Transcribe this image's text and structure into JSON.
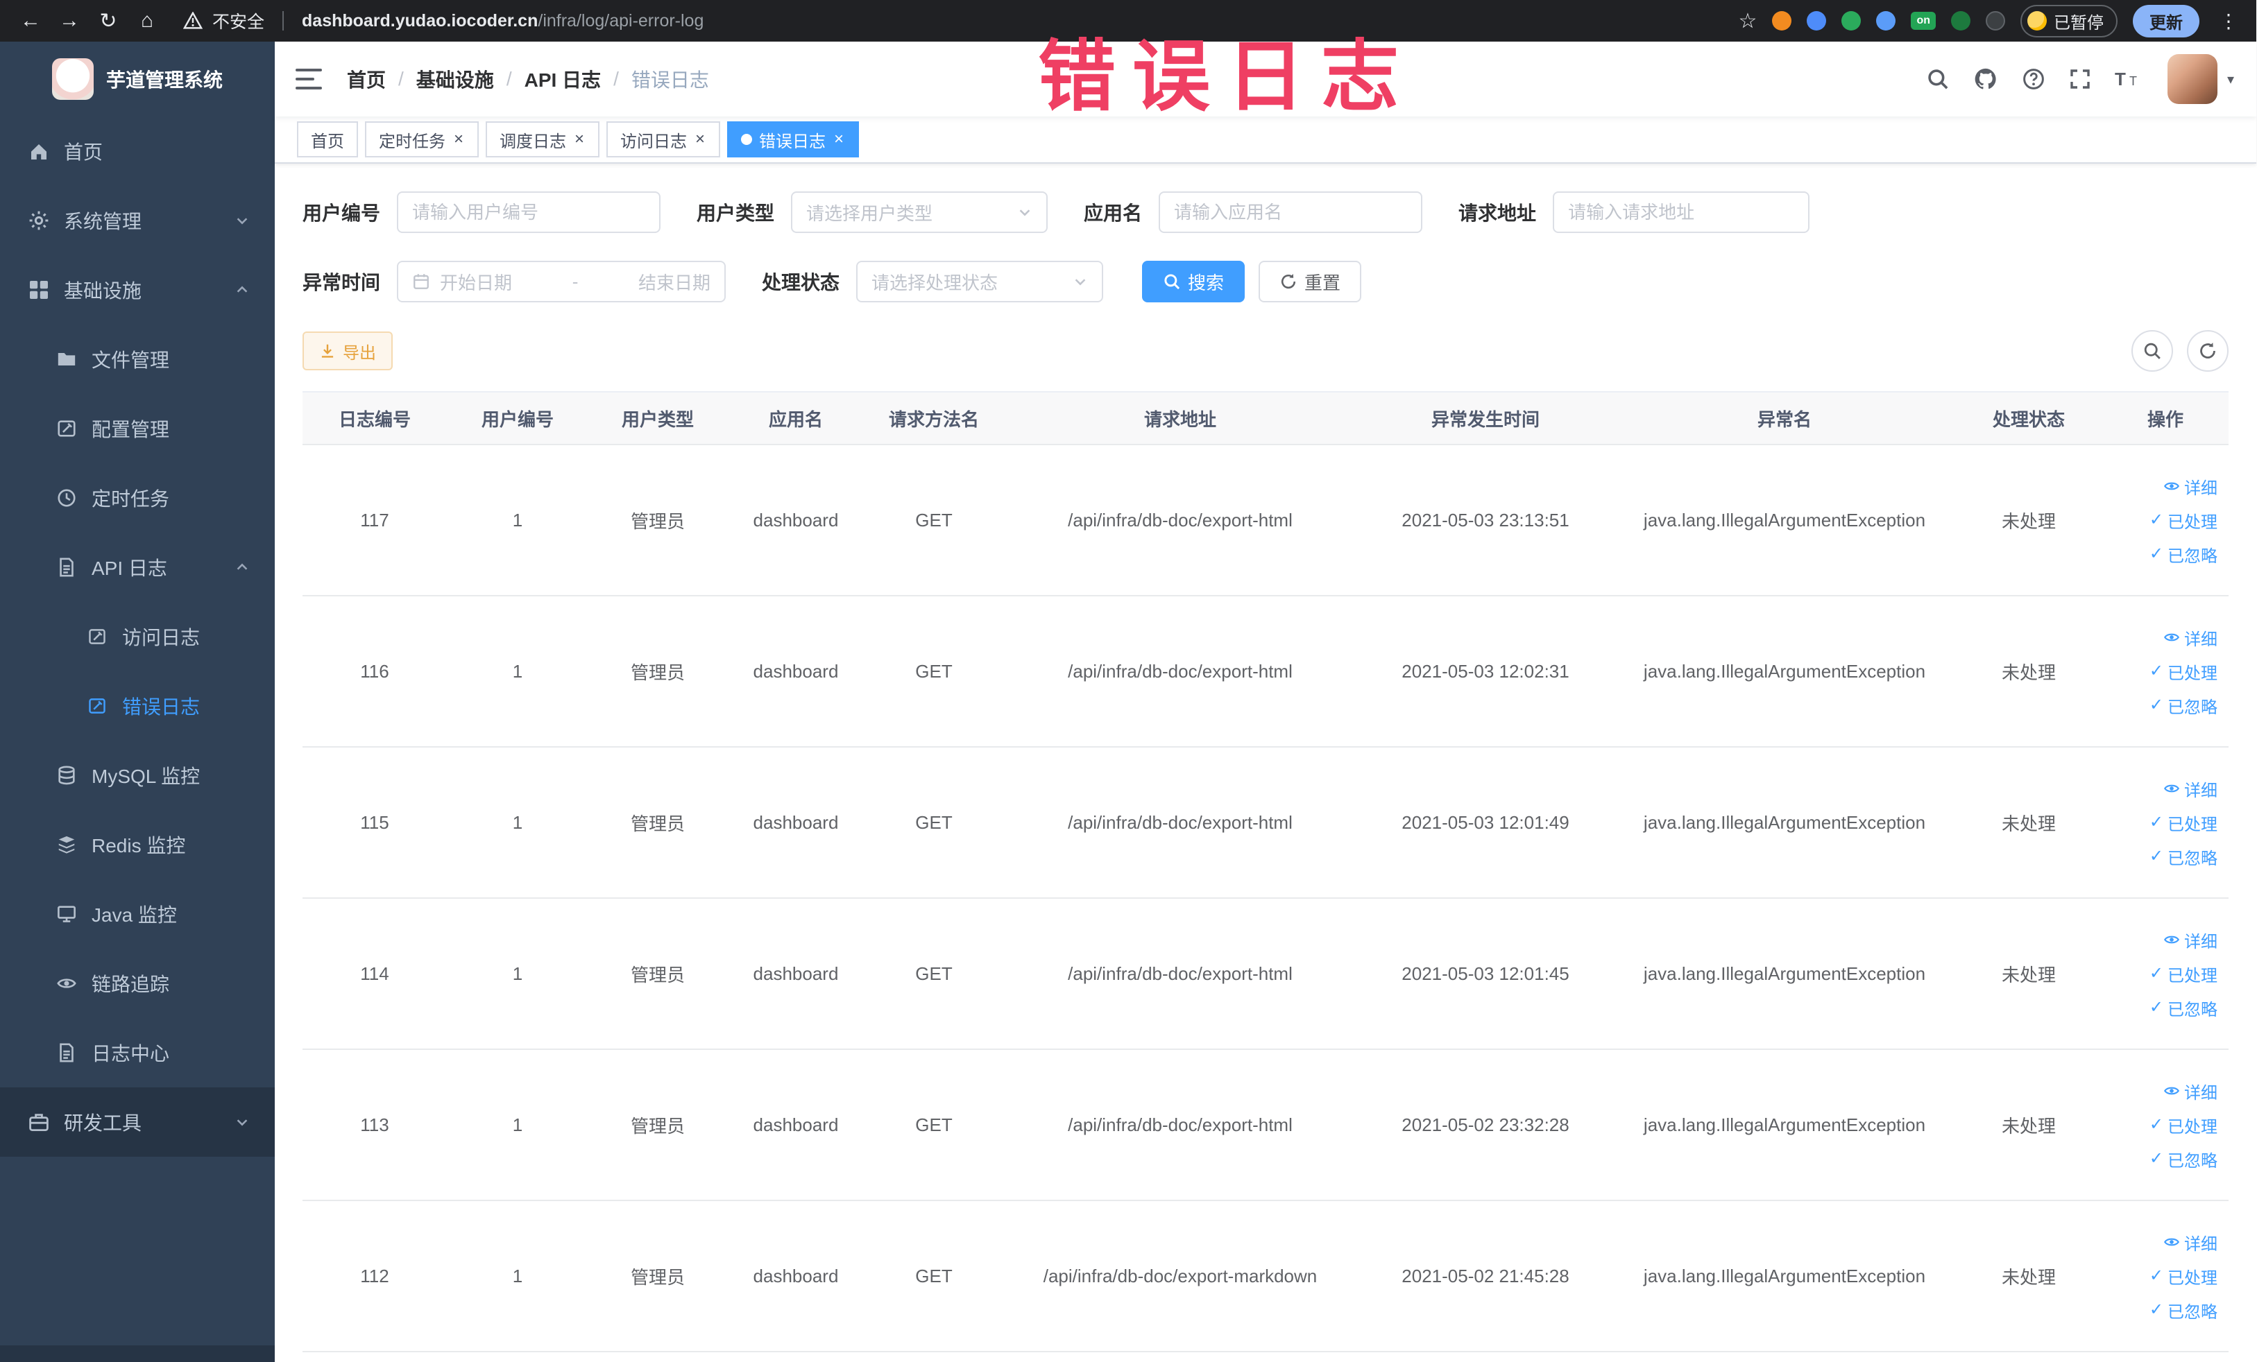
{
  "chrome": {
    "security_label": "不安全",
    "url_host": "dashboard.yudao.iocoder.cn",
    "url_path": "/infra/log/api-error-log",
    "on_badge": "on",
    "paused_badge": "已暂停",
    "update_button": "更新"
  },
  "icons": {
    "back_arrow": "←",
    "forward_arrow": "→",
    "reload": "↻",
    "home": "⌂",
    "star": "☆",
    "kebab": "⋮",
    "caret_down": "▾",
    "check": "✓",
    "close": "×"
  },
  "sidebar": {
    "title": "芋道管理系统",
    "items": [
      {
        "label": "首页"
      },
      {
        "label": "系统管理"
      },
      {
        "label": "基础设施"
      },
      {
        "label": "文件管理"
      },
      {
        "label": "配置管理"
      },
      {
        "label": "定时任务"
      },
      {
        "label": "API 日志"
      },
      {
        "label": "访问日志"
      },
      {
        "label": "错误日志"
      },
      {
        "label": "MySQL 监控"
      },
      {
        "label": "Redis 监控"
      },
      {
        "label": "Java 监控"
      },
      {
        "label": "链路追踪"
      },
      {
        "label": "日志中心"
      },
      {
        "label": "研发工具"
      }
    ]
  },
  "navbar": {
    "breadcrumb": [
      "首页",
      "基础设施",
      "API 日志",
      "错误日志"
    ],
    "separator": "/"
  },
  "watermark": "错误日志",
  "tabs": [
    {
      "label": "首页"
    },
    {
      "label": "定时任务"
    },
    {
      "label": "调度日志"
    },
    {
      "label": "访问日志"
    },
    {
      "label": "错误日志"
    }
  ],
  "filters": {
    "user_id": {
      "label": "用户编号",
      "placeholder": "请输入用户编号"
    },
    "user_type": {
      "label": "用户类型",
      "placeholder": "请选择用户类型"
    },
    "app_name": {
      "label": "应用名",
      "placeholder": "请输入应用名"
    },
    "request_url": {
      "label": "请求地址",
      "placeholder": "请输入请求地址"
    },
    "exception_time": {
      "label": "异常时间",
      "start_placeholder": "开始日期",
      "separator": "-",
      "end_placeholder": "结束日期"
    },
    "process_status": {
      "label": "处理状态",
      "placeholder": "请选择处理状态"
    },
    "search_label": "搜索",
    "reset_label": "重置"
  },
  "toolbar": {
    "export_label": "导出"
  },
  "table": {
    "headers": [
      "日志编号",
      "用户编号",
      "用户类型",
      "应用名",
      "请求方法名",
      "请求地址",
      "异常发生时间",
      "异常名",
      "处理状态",
      "操作"
    ],
    "actions": {
      "detail": "详细",
      "processed": "已处理",
      "ignored": "已忽略"
    },
    "rows": [
      {
        "id": "117",
        "user_id": "1",
        "user_type": "管理员",
        "app_name": "dashboard",
        "method": "GET",
        "url": "/api/infra/db-doc/export-html",
        "time": "2021-05-03 23:13:51",
        "exception": "java.lang.IllegalArgumentException",
        "status": "未处理"
      },
      {
        "id": "116",
        "user_id": "1",
        "user_type": "管理员",
        "app_name": "dashboard",
        "method": "GET",
        "url": "/api/infra/db-doc/export-html",
        "time": "2021-05-03 12:02:31",
        "exception": "java.lang.IllegalArgumentException",
        "status": "未处理"
      },
      {
        "id": "115",
        "user_id": "1",
        "user_type": "管理员",
        "app_name": "dashboard",
        "method": "GET",
        "url": "/api/infra/db-doc/export-html",
        "time": "2021-05-03 12:01:49",
        "exception": "java.lang.IllegalArgumentException",
        "status": "未处理"
      },
      {
        "id": "114",
        "user_id": "1",
        "user_type": "管理员",
        "app_name": "dashboard",
        "method": "GET",
        "url": "/api/infra/db-doc/export-html",
        "time": "2021-05-03 12:01:45",
        "exception": "java.lang.IllegalArgumentException",
        "status": "未处理"
      },
      {
        "id": "113",
        "user_id": "1",
        "user_type": "管理员",
        "app_name": "dashboard",
        "method": "GET",
        "url": "/api/infra/db-doc/export-html",
        "time": "2021-05-02 23:32:28",
        "exception": "java.lang.IllegalArgumentException",
        "status": "未处理"
      },
      {
        "id": "112",
        "user_id": "1",
        "user_type": "管理员",
        "app_name": "dashboard",
        "method": "GET",
        "url": "/api/infra/db-doc/export-markdown",
        "time": "2021-05-02 21:45:28",
        "exception": "java.lang.IllegalArgumentException",
        "status": "未处理"
      }
    ]
  }
}
